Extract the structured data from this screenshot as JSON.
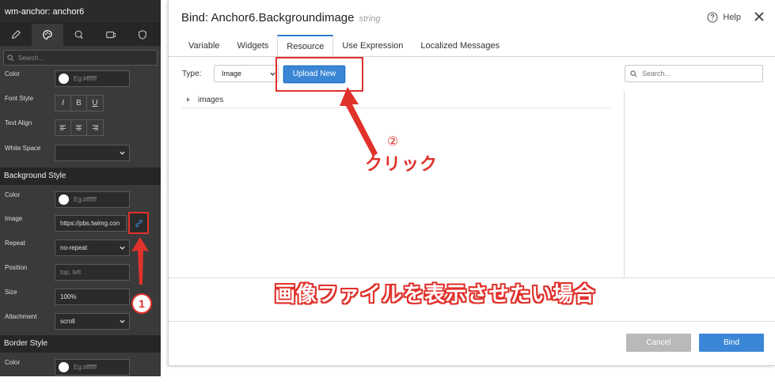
{
  "panel": {
    "title": "wm-anchor: anchor6",
    "search_placeholder": "Search...",
    "rows": {
      "color": {
        "label": "Color",
        "placeholder": "Eg:#ffffff"
      },
      "font_style": {
        "label": "Font Style",
        "buttons": [
          "I",
          "B",
          "U"
        ]
      },
      "text_align": {
        "label": "Text Align"
      },
      "white_space": {
        "label": "White Space",
        "value": ""
      }
    },
    "background_section": "Background Style",
    "bg": {
      "color": {
        "label": "Color",
        "placeholder": "Eg:#ffffff"
      },
      "image": {
        "label": "Image",
        "value": "https://pbs.twimg.con"
      },
      "repeat": {
        "label": "Repeat",
        "value": "no-repeat"
      },
      "position": {
        "label": "Position",
        "placeholder": "top, left"
      },
      "size": {
        "label": "Size",
        "value": "100%"
      },
      "attachment": {
        "label": "Attachment",
        "value": "scroll"
      }
    },
    "border_section": "Border Style",
    "border": {
      "color": {
        "label": "Color",
        "placeholder": "Eg:#ffffff"
      }
    }
  },
  "dialog": {
    "title": "Bind: Anchor6.Backgroundimage",
    "type": "string",
    "help": "Help",
    "tabs": [
      "Variable",
      "Widgets",
      "Resource",
      "Use Expression",
      "Localized Messages"
    ],
    "active_tab": "Resource",
    "type_label": "Type:",
    "type_value": "Image",
    "upload_button": "Upload New",
    "search_placeholder": "Search...",
    "tree": [
      "images"
    ],
    "cancel": "Cancel",
    "bind": "Bind"
  },
  "annotations": {
    "step1": "1",
    "step2": "②",
    "click": "クリック",
    "caption": "画像ファイルを表示させたい場合"
  },
  "colors": {
    "accent": "#3b86d6",
    "annotation": "#e0312b",
    "panel_bg": "#3a3a3a"
  }
}
